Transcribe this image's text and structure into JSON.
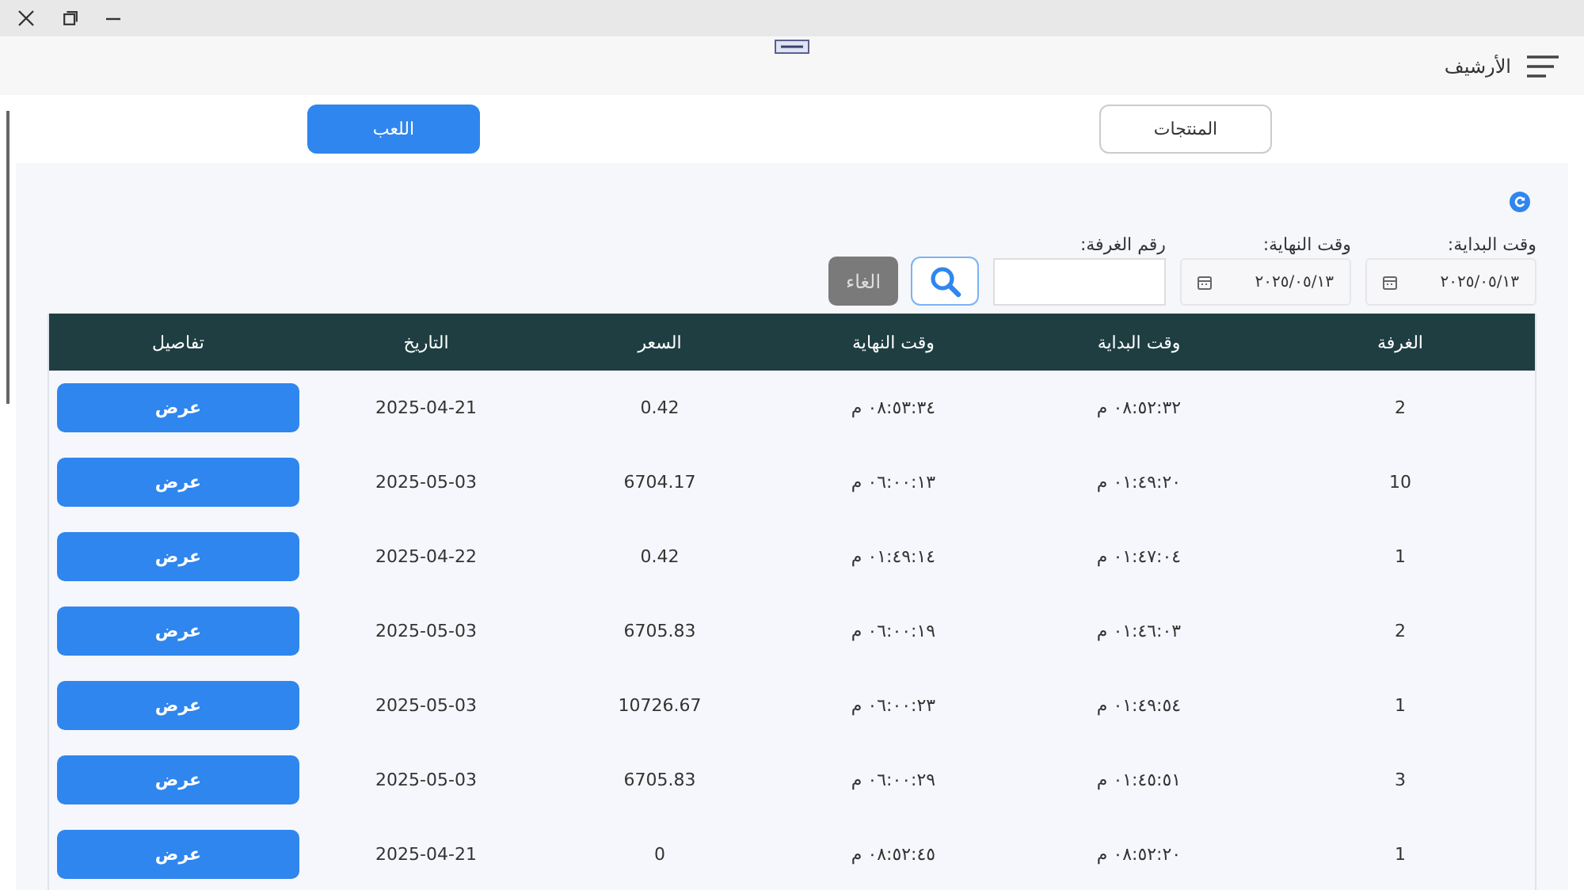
{
  "header": {
    "title": "الأرشيف"
  },
  "tabs": [
    {
      "label": "المنتجات",
      "selected": false
    },
    {
      "label": "اللعب",
      "selected": true
    }
  ],
  "filters": {
    "start": {
      "label": "وقت البداية:",
      "value": "٢٠٢٥/٠٥/١٣"
    },
    "end": {
      "label": "وقت النهاية:",
      "value": "٢٠٢٥/٠٥/١٣"
    },
    "room": {
      "label": "رقم الغرفة:"
    },
    "cancel_button": {
      "label": "الغاء",
      "disabled": true
    }
  },
  "table": {
    "columns": [
      "الغرفة",
      "وقت البداية",
      "وقت النهاية",
      "السعر",
      "التاريخ",
      "تفاصيل"
    ],
    "rows": [
      {
        "room": "2",
        "start": "٠٨:٥٢:٣٢ م",
        "end": "٠٨:٥٣:٣٤ م",
        "price": "0.42",
        "date": "2025-04-21",
        "action": "عرض"
      },
      {
        "room": "10",
        "start": "٠١:٤٩:٢٠ م",
        "end": "٠٦:٠٠:١٣ م",
        "price": "6704.17",
        "date": "2025-05-03",
        "action": "عرض"
      },
      {
        "room": "1",
        "start": "٠١:٤٧:٠٤ م",
        "end": "٠١:٤٩:١٤ م",
        "price": "0.42",
        "date": "2025-04-22",
        "action": "عرض"
      },
      {
        "room": "2",
        "start": "٠١:٤٦:٠٣ م",
        "end": "٠٦:٠٠:١٩ م",
        "price": "6705.83",
        "date": "2025-05-03",
        "action": "عرض"
      },
      {
        "room": "1",
        "start": "٠١:٤٩:٥٤ م",
        "end": "٠٦:٠٠:٢٣ م",
        "price": "10726.67",
        "date": "2025-05-03",
        "action": "عرض"
      },
      {
        "room": "3",
        "start": "٠١:٤٥:٥١ م",
        "end": "٠٦:٠٠:٢٩ م",
        "price": "6705.83",
        "date": "2025-05-03",
        "action": "عرض"
      },
      {
        "room": "1",
        "start": "٠٨:٥٢:٢٠ م",
        "end": "٠٨:٥٢:٤٥ م",
        "price": "0",
        "date": "2025-04-21",
        "action": "عرض"
      }
    ]
  }
}
